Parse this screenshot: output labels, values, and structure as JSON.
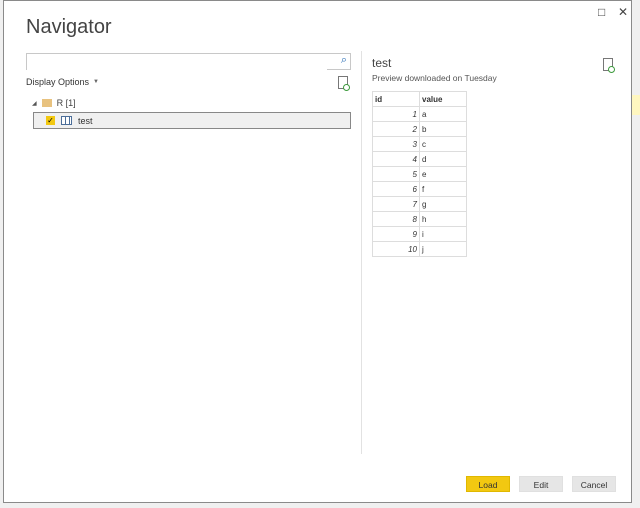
{
  "dialog": {
    "title": "Navigator",
    "maximize_icon": "□",
    "close_icon": "✕"
  },
  "left": {
    "search_placeholder": "",
    "search_icon": "⌕",
    "display_options": "Display Options",
    "tree_root": "R [1]",
    "item": "test"
  },
  "preview": {
    "title": "test",
    "subtitle": "Preview downloaded on Tuesday",
    "columns": [
      "id",
      "value"
    ],
    "rows": [
      [
        "1",
        "a"
      ],
      [
        "2",
        "b"
      ],
      [
        "3",
        "c"
      ],
      [
        "4",
        "d"
      ],
      [
        "5",
        "e"
      ],
      [
        "6",
        "f"
      ],
      [
        "7",
        "g"
      ],
      [
        "8",
        "h"
      ],
      [
        "9",
        "i"
      ],
      [
        "10",
        "j"
      ]
    ]
  },
  "buttons": {
    "load": "Load",
    "edit": "Edit",
    "cancel": "Cancel"
  },
  "colors": {
    "accent": "#f2c811"
  }
}
